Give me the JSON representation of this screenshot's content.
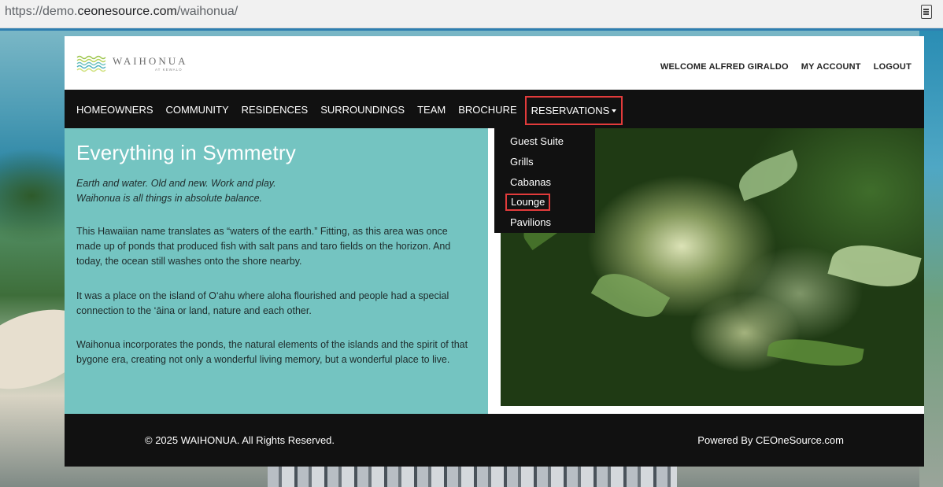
{
  "browser": {
    "url_prefix": "https://demo.",
    "url_host": "ceonesource.com",
    "url_path": "/waihonua/",
    "reader_icon": "reader-mode-icon"
  },
  "header": {
    "logo_text": "WAIHONUA",
    "logo_sub": "AT KEWALO",
    "welcome": "WELCOME ALFRED GIRALDO",
    "my_account": "MY ACCOUNT",
    "logout": "LOGOUT"
  },
  "nav": {
    "items": [
      "HOMEOWNERS",
      "COMMUNITY",
      "RESIDENCES",
      "SURROUNDINGS",
      "TEAM",
      "BROCHURE"
    ],
    "reservations": "RESERVATIONS"
  },
  "dropdown": {
    "items": [
      "Guest Suite",
      "Grills",
      "Cabanas",
      "Lounge",
      "Pavilions"
    ]
  },
  "content": {
    "title": "Everything in Symmetry",
    "tagline_1": "Earth and water. Old and new. Work and play.",
    "tagline_2": "Waihonua is all things in absolute balance.",
    "para_1": "This Hawaiian name translates as “waters of the earth.” Fitting, as this area was once made up of ponds that produced fish with salt pans and taro fields on the horizon. And today, the ocean still washes onto the shore nearby.",
    "para_2": "It was a place on the island of O‘ahu where aloha flourished and people had a special connection to the ‘āina or land, nature and each other.",
    "para_3": "Waihonua incorporates the ponds, the natural elements of the islands and the spirit of that bygone era, creating not only a wonderful living memory, but a wonderful place to live."
  },
  "footer": {
    "copyright": "© 2025 WAIHONUA. All Rights Reserved.",
    "powered": "Powered By CEOneSource.com"
  },
  "colors": {
    "teal_panel": "#74c4c1",
    "nav_bg": "#111111",
    "highlight_border": "#e23b3b"
  }
}
